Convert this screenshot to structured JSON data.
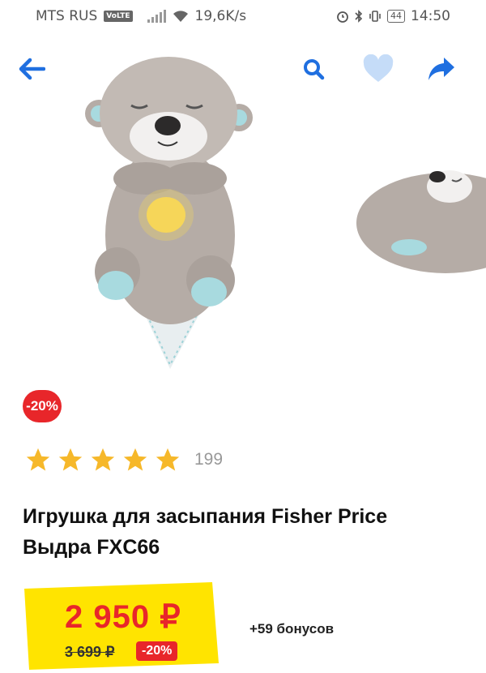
{
  "status": {
    "carrier": "MTS RUS",
    "volte": "VoLTE",
    "speed": "19,6K/s",
    "battery": "44",
    "time": "14:50"
  },
  "toolbar": {
    "back": "arrow-left-icon",
    "search": "search-icon",
    "favorite": "heart-icon",
    "share": "share-icon",
    "accent": "#1f6fe0"
  },
  "product": {
    "discount_badge": "-20%",
    "rating": 5,
    "reviews_count": "199",
    "title": "Игрушка для засыпания Fisher Price Выдра FXC66",
    "price_current": "2 950 ₽",
    "price_old": "3 699 ₽",
    "price_discount": "-20%",
    "bonus": "+59 бонусов"
  },
  "colors": {
    "red": "#e8262a",
    "yellow": "#ffe400",
    "star": "#f6b82a"
  }
}
